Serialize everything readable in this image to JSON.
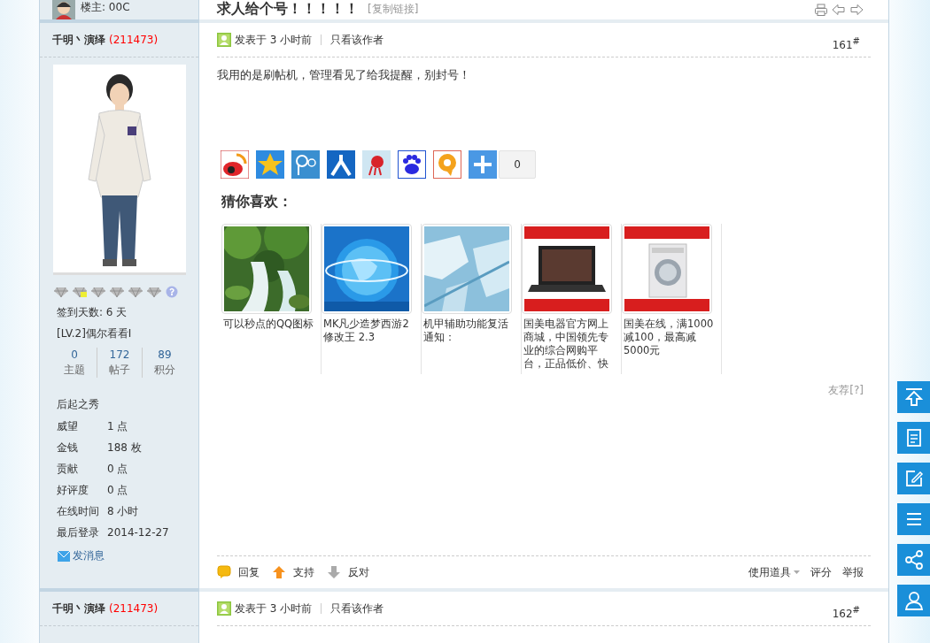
{
  "thread": {
    "starter": "楼主: 00C",
    "title": "求人给个号！！！！！",
    "copy_link": "[复制链接]"
  },
  "posts": [
    {
      "author": "千明丶演绎",
      "uid": "(211473)",
      "medals": [
        {
          "kind": "diamond"
        },
        {
          "kind": "badge"
        },
        {
          "kind": "diamond"
        },
        {
          "kind": "diamond"
        },
        {
          "kind": "diamond"
        },
        {
          "kind": "diamond"
        },
        {
          "kind": "help"
        }
      ],
      "checkin": "签到天数: 6 天",
      "level": "[LV.2]偶尔看看I",
      "stats": [
        {
          "value": "0",
          "label": "主题"
        },
        {
          "value": "172",
          "label": "帖子"
        },
        {
          "value": "89",
          "label": "积分"
        }
      ],
      "rank": "后起之秀",
      "profile": [
        {
          "label": "威望",
          "value": "1 点"
        },
        {
          "label": "金钱",
          "value": "188 枚"
        },
        {
          "label": "贡献",
          "value": "0 点"
        },
        {
          "label": "好评度",
          "value": "0 点"
        },
        {
          "label": "在线时间",
          "value": "8 小时"
        },
        {
          "label": "最后登录",
          "value": "2014-12-27"
        }
      ],
      "message": "发消息",
      "posted": "发表于 3 小时前",
      "only_author": "只看该作者",
      "floor": "161$^{#}$",
      "body": "我用的是刷帖机，管理看见了给我提醒，别封号！",
      "share": [
        {
          "kind": "weibo"
        },
        {
          "kind": "qzone"
        },
        {
          "kind": "tqq"
        },
        {
          "kind": "renren"
        },
        {
          "kind": "tsohu"
        },
        {
          "kind": "baidu"
        },
        {
          "kind": "qq"
        },
        {
          "kind": "more"
        }
      ],
      "share_count": "0",
      "recommend_title": "猜你喜欢：",
      "recommendations": [
        {
          "kind": "waterfall",
          "caption": "可以秒点的QQ图标"
        },
        {
          "kind": "globe",
          "caption": "MK凡少造梦西游2修改王 2.3"
        },
        {
          "kind": "map",
          "caption": "机甲辅助功能复活通知："
        },
        {
          "kind": "laptop",
          "caption": "国美电器官方网上商城，中国领先专业的综合网购平台，正品低价、快"
        },
        {
          "kind": "washer",
          "caption": "国美在线，满1000减100，最高减5000元"
        }
      ],
      "recommend_link": "友荐[?]",
      "actions": [
        {
          "kind": "reply",
          "label": "回复"
        },
        {
          "kind": "support",
          "label": "支持"
        },
        {
          "kind": "oppose",
          "label": "反对"
        }
      ],
      "tools": [
        {
          "label": "使用道具",
          "dropdown": true
        },
        {
          "label": "评分",
          "dropdown": false
        },
        {
          "label": "举报",
          "dropdown": false
        }
      ]
    },
    {
      "author": "千明丶演绎",
      "uid": "(211473)",
      "posted": "发表于 3 小时前",
      "only_author": "只看该作者",
      "floor": "162$^{#}$"
    }
  ],
  "side_buttons": [
    {
      "kind": "top"
    },
    {
      "kind": "doc"
    },
    {
      "kind": "edit"
    },
    {
      "kind": "list"
    },
    {
      "kind": "share"
    },
    {
      "kind": "user"
    }
  ]
}
